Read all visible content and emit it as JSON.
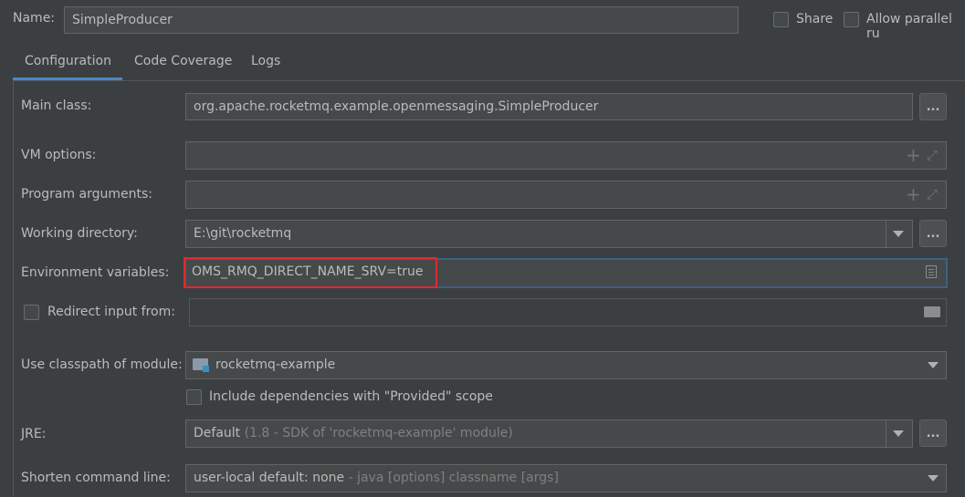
{
  "header": {
    "name_label": "Name:",
    "name_value": "SimpleProducer",
    "share_label": "Share",
    "allow_parallel_label": "Allow parallel ru"
  },
  "tabs": [
    {
      "label": "Configuration",
      "active": true
    },
    {
      "label": "Code Coverage",
      "active": false
    },
    {
      "label": "Logs",
      "active": false
    }
  ],
  "form": {
    "main_class": {
      "label": "Main class:",
      "value": "org.apache.rocketmq.example.openmessaging.SimpleProducer",
      "button": "..."
    },
    "vm_options": {
      "label": "VM options:",
      "value": ""
    },
    "program_arguments": {
      "label": "Program arguments:",
      "value": ""
    },
    "working_directory": {
      "label": "Working directory:",
      "value": "E:\\git\\rocketmq",
      "button": "..."
    },
    "environment_variables": {
      "label": "Environment variables:",
      "value": "OMS_RMQ_DIRECT_NAME_SRV=true"
    },
    "redirect_input": {
      "label": "Redirect input from:",
      "value": "",
      "checked": false
    },
    "classpath_module": {
      "label": "Use classpath of module:",
      "value": "rocketmq-example"
    },
    "include_provided": {
      "label": "Include dependencies with \"Provided\" scope",
      "checked": false
    },
    "jre": {
      "label": "JRE:",
      "value_main": "Default",
      "value_dim": "(1.8 - SDK of 'rocketmq-example' module)",
      "button": "..."
    },
    "shorten_command_line": {
      "label": "Shorten command line:",
      "value_main": "user-local default: none",
      "value_dim": "- java [options] classname [args]"
    }
  },
  "colors": {
    "background": "#3c3f41",
    "field_bg": "#45494a",
    "accent_tab": "#4a88c7",
    "focus_border": "#3d6185",
    "highlight_box": "#e0292f"
  }
}
